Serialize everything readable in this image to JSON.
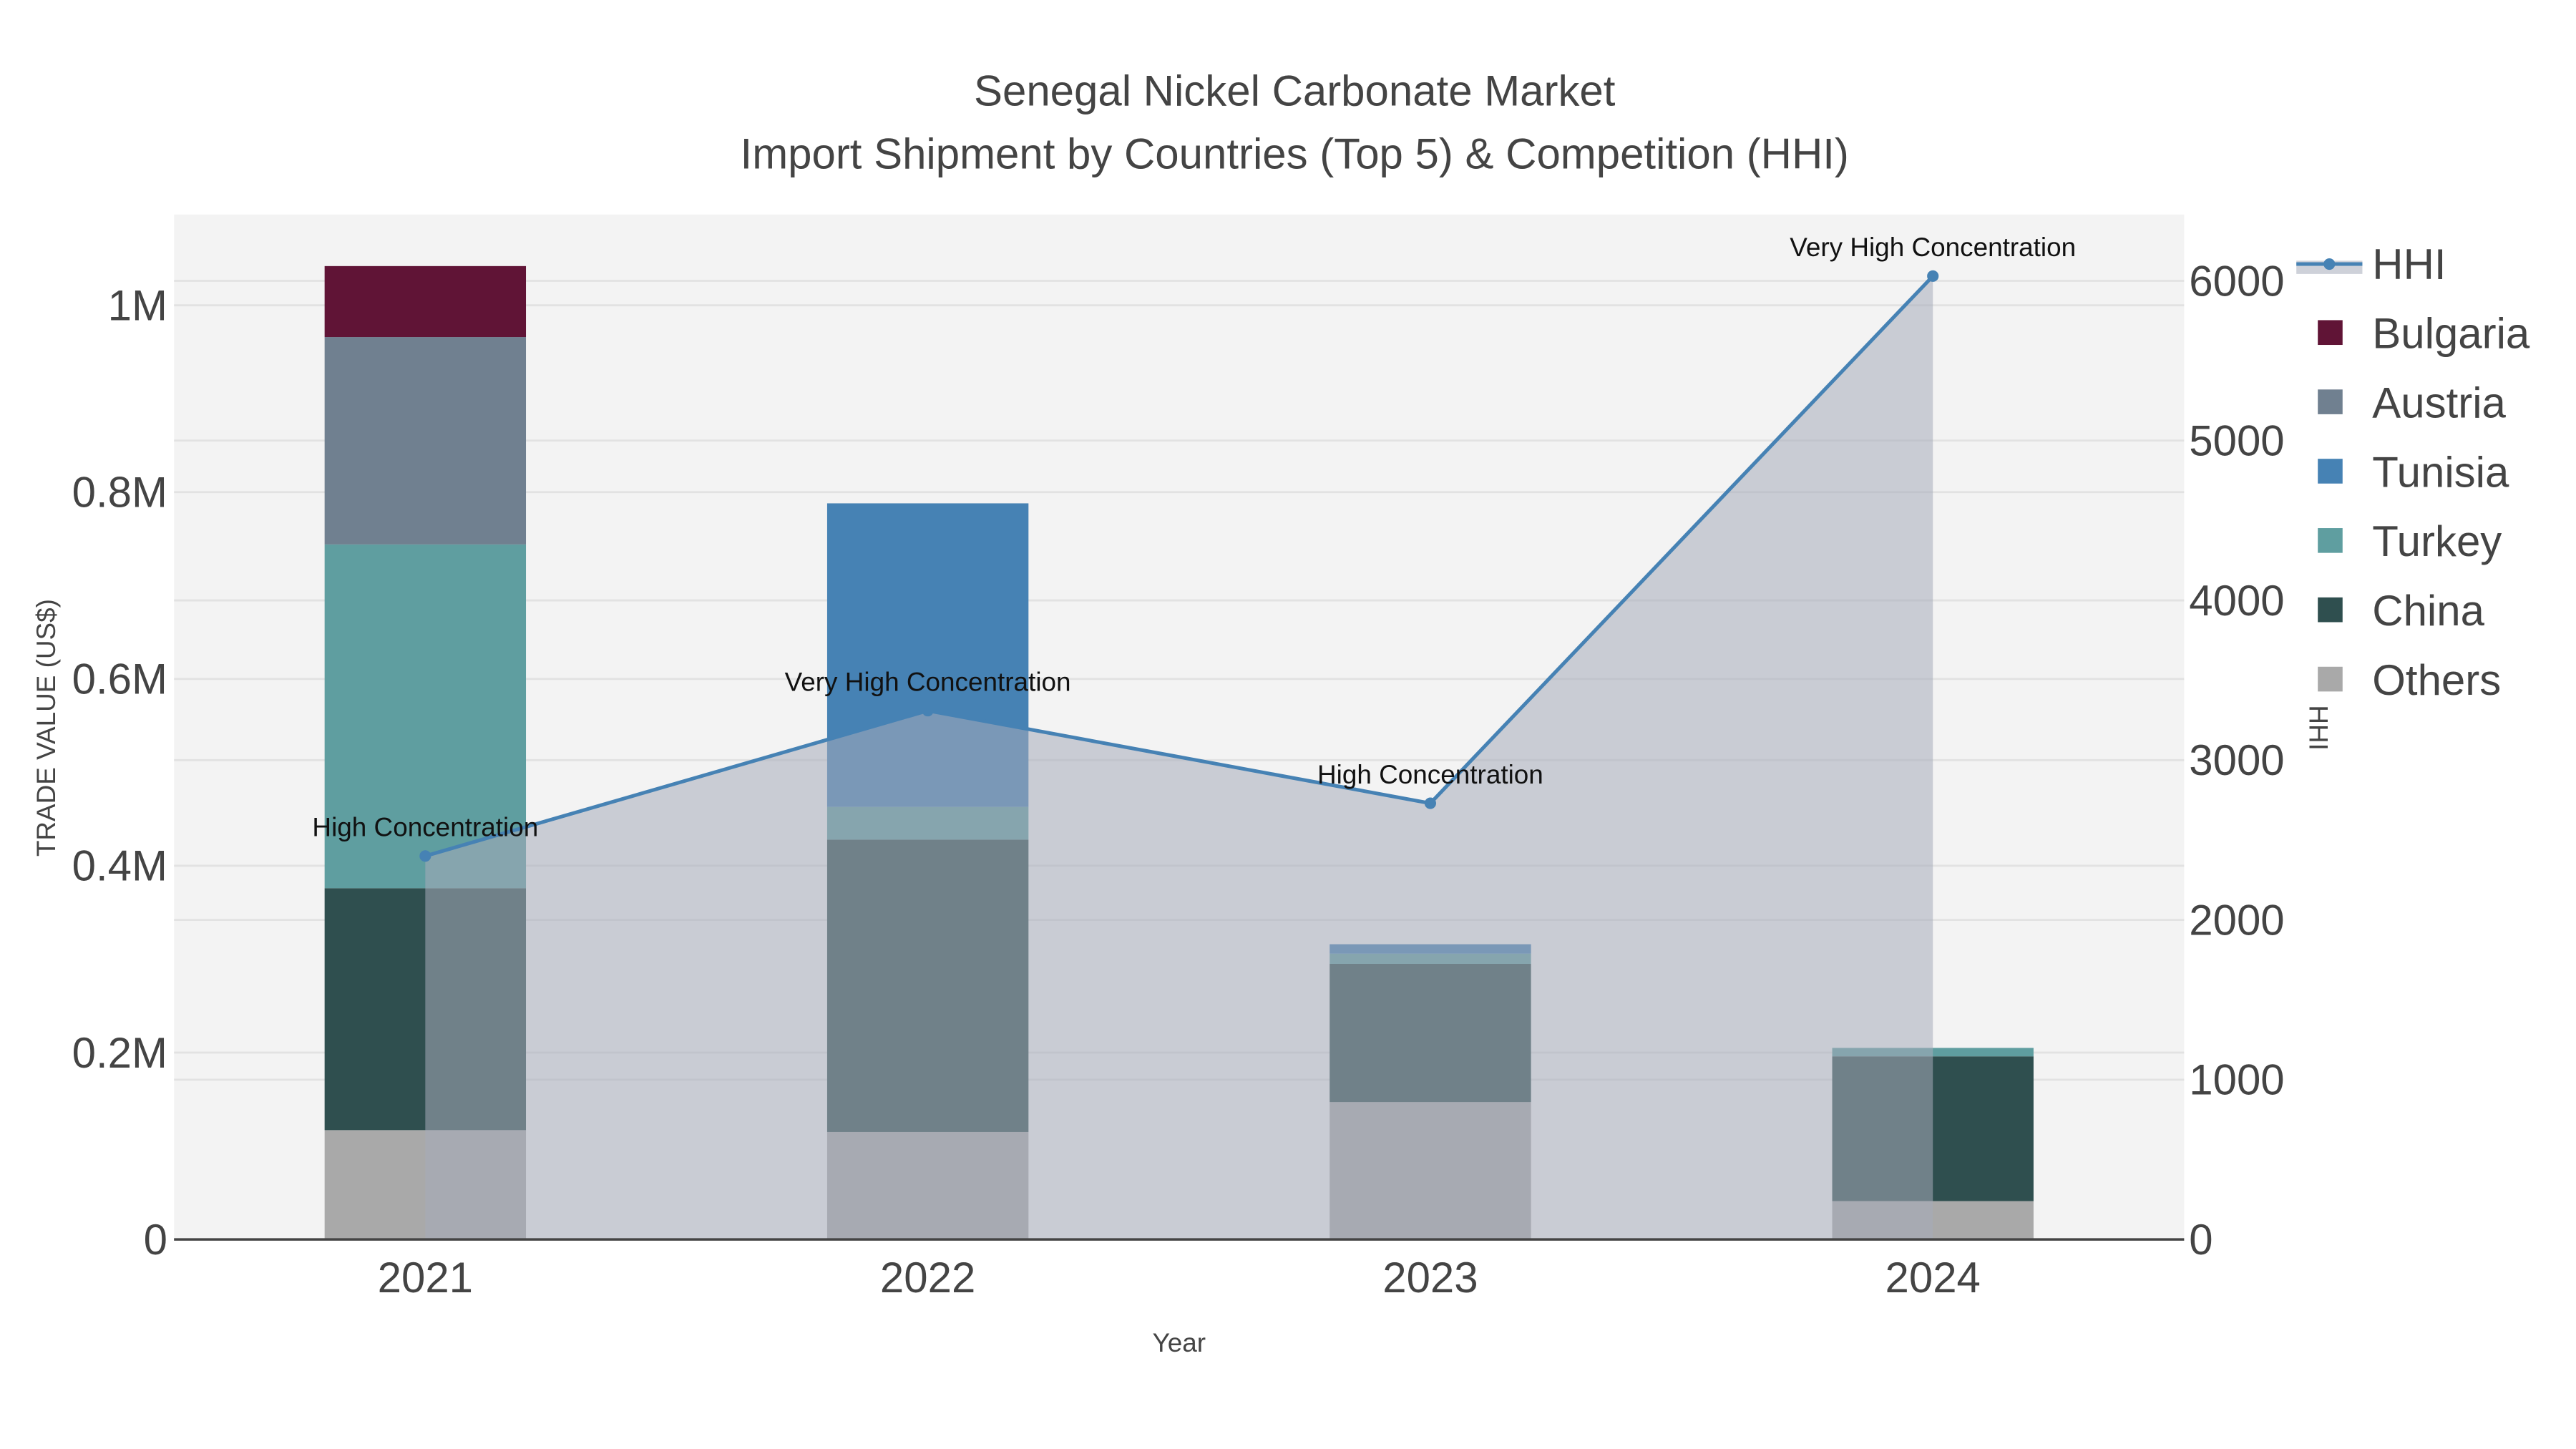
{
  "chart_data": {
    "type": "bar",
    "title": "Senegal Nickel Carbonate Market",
    "subtitle": "Import Shipment by Countries (Top 5) & Competition (HHI)",
    "xlabel": "Year",
    "ylabel": "TRADE VALUE (US$)",
    "y2label": "HHI",
    "categories": [
      "2021",
      "2022",
      "2023",
      "2024"
    ],
    "ylim": [
      0,
      1.1
    ],
    "y_ticks": [
      {
        "v": 0,
        "label": "0"
      },
      {
        "v": 0.2,
        "label": "0.2M"
      },
      {
        "v": 0.4,
        "label": "0.4M"
      },
      {
        "v": 0.6,
        "label": "0.6M"
      },
      {
        "v": 0.8,
        "label": "0.8M"
      },
      {
        "v": 1.0,
        "label": "1M"
      }
    ],
    "y_unit": "million US$",
    "y2lim": [
      0,
      6414
    ],
    "y2_ticks": [
      {
        "v": 0,
        "label": "0"
      },
      {
        "v": 1000,
        "label": "1000"
      },
      {
        "v": 2000,
        "label": "2000"
      },
      {
        "v": 3000,
        "label": "3000"
      },
      {
        "v": 4000,
        "label": "4000"
      },
      {
        "v": 5000,
        "label": "5000"
      },
      {
        "v": 6000,
        "label": "6000"
      }
    ],
    "stacked": true,
    "series": [
      {
        "name": "Others",
        "color": "#a9a9a9",
        "values": [
          0.117,
          0.115,
          0.147,
          0.041
        ]
      },
      {
        "name": "China",
        "color": "#2f4f4f",
        "values": [
          0.259,
          0.313,
          0.148,
          0.155
        ]
      },
      {
        "name": "Turkey",
        "color": "#5f9ea0",
        "values": [
          0.368,
          0.035,
          0.011,
          0.009
        ]
      },
      {
        "name": "Tunisia",
        "color": "#4682b4",
        "values": [
          0,
          0.325,
          0.01,
          0
        ]
      },
      {
        "name": "Austria",
        "color": "#708090",
        "values": [
          0.222,
          0,
          0,
          0
        ]
      },
      {
        "name": "Bulgaria",
        "color": "#601436",
        "values": [
          0.076,
          0,
          0,
          0
        ]
      }
    ],
    "hhi": {
      "name": "HHI",
      "color": "#4682b4",
      "values": [
        2400,
        3310,
        2730,
        6030
      ],
      "annotations": [
        "High Concentration",
        "Very High Concentration",
        "High Concentration",
        "Very High Concentration"
      ]
    },
    "legend_order": [
      "HHI",
      "Bulgaria",
      "Austria",
      "Tunisia",
      "Turkey",
      "China",
      "Others"
    ],
    "legend_position": "right",
    "grid": true
  }
}
